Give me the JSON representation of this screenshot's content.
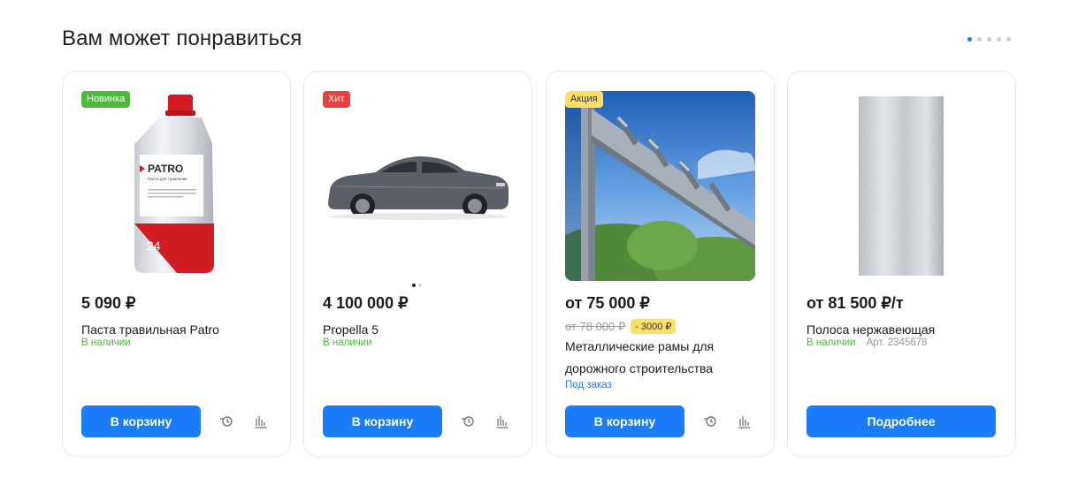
{
  "section": {
    "title": "Вам может понравиться",
    "pager_pages": 5,
    "pager_active": 1
  },
  "products": [
    {
      "badge": "Новинка",
      "price": "5 090 ₽",
      "name": "Паста травильная Patro",
      "stock": "В наличии",
      "bottle": {
        "brand": "PATRO",
        "subtitle": "Паста для травления",
        "number": "24"
      },
      "button": "В корзину"
    },
    {
      "badge": "Хит",
      "price": "4 100 000 ₽",
      "name": "Propella 5",
      "stock": "В наличии",
      "button": "В корзину"
    },
    {
      "badge": "Акция",
      "price": "от 75 000 ₽",
      "old_price": "от 78 000 ₽",
      "discount": "- 3000 ₽",
      "name": "Металлические рамы для дорожного строительства",
      "stock": "Под заказ",
      "button": "В корзину"
    },
    {
      "price": "от 81 500 ₽/т",
      "name": "Полоса нержавеющая",
      "stock": "В наличии",
      "article": "Арт. 2345678",
      "button": "Подробнее"
    }
  ],
  "colors": {
    "accent": "#1a7cf7",
    "in_stock": "#4cbb3c",
    "badge_new": "#4cbb3c",
    "badge_hit": "#e8423f",
    "badge_sale": "#ffe066"
  },
  "icons": {
    "history": "history-icon",
    "compare": "compare-chart-icon"
  }
}
